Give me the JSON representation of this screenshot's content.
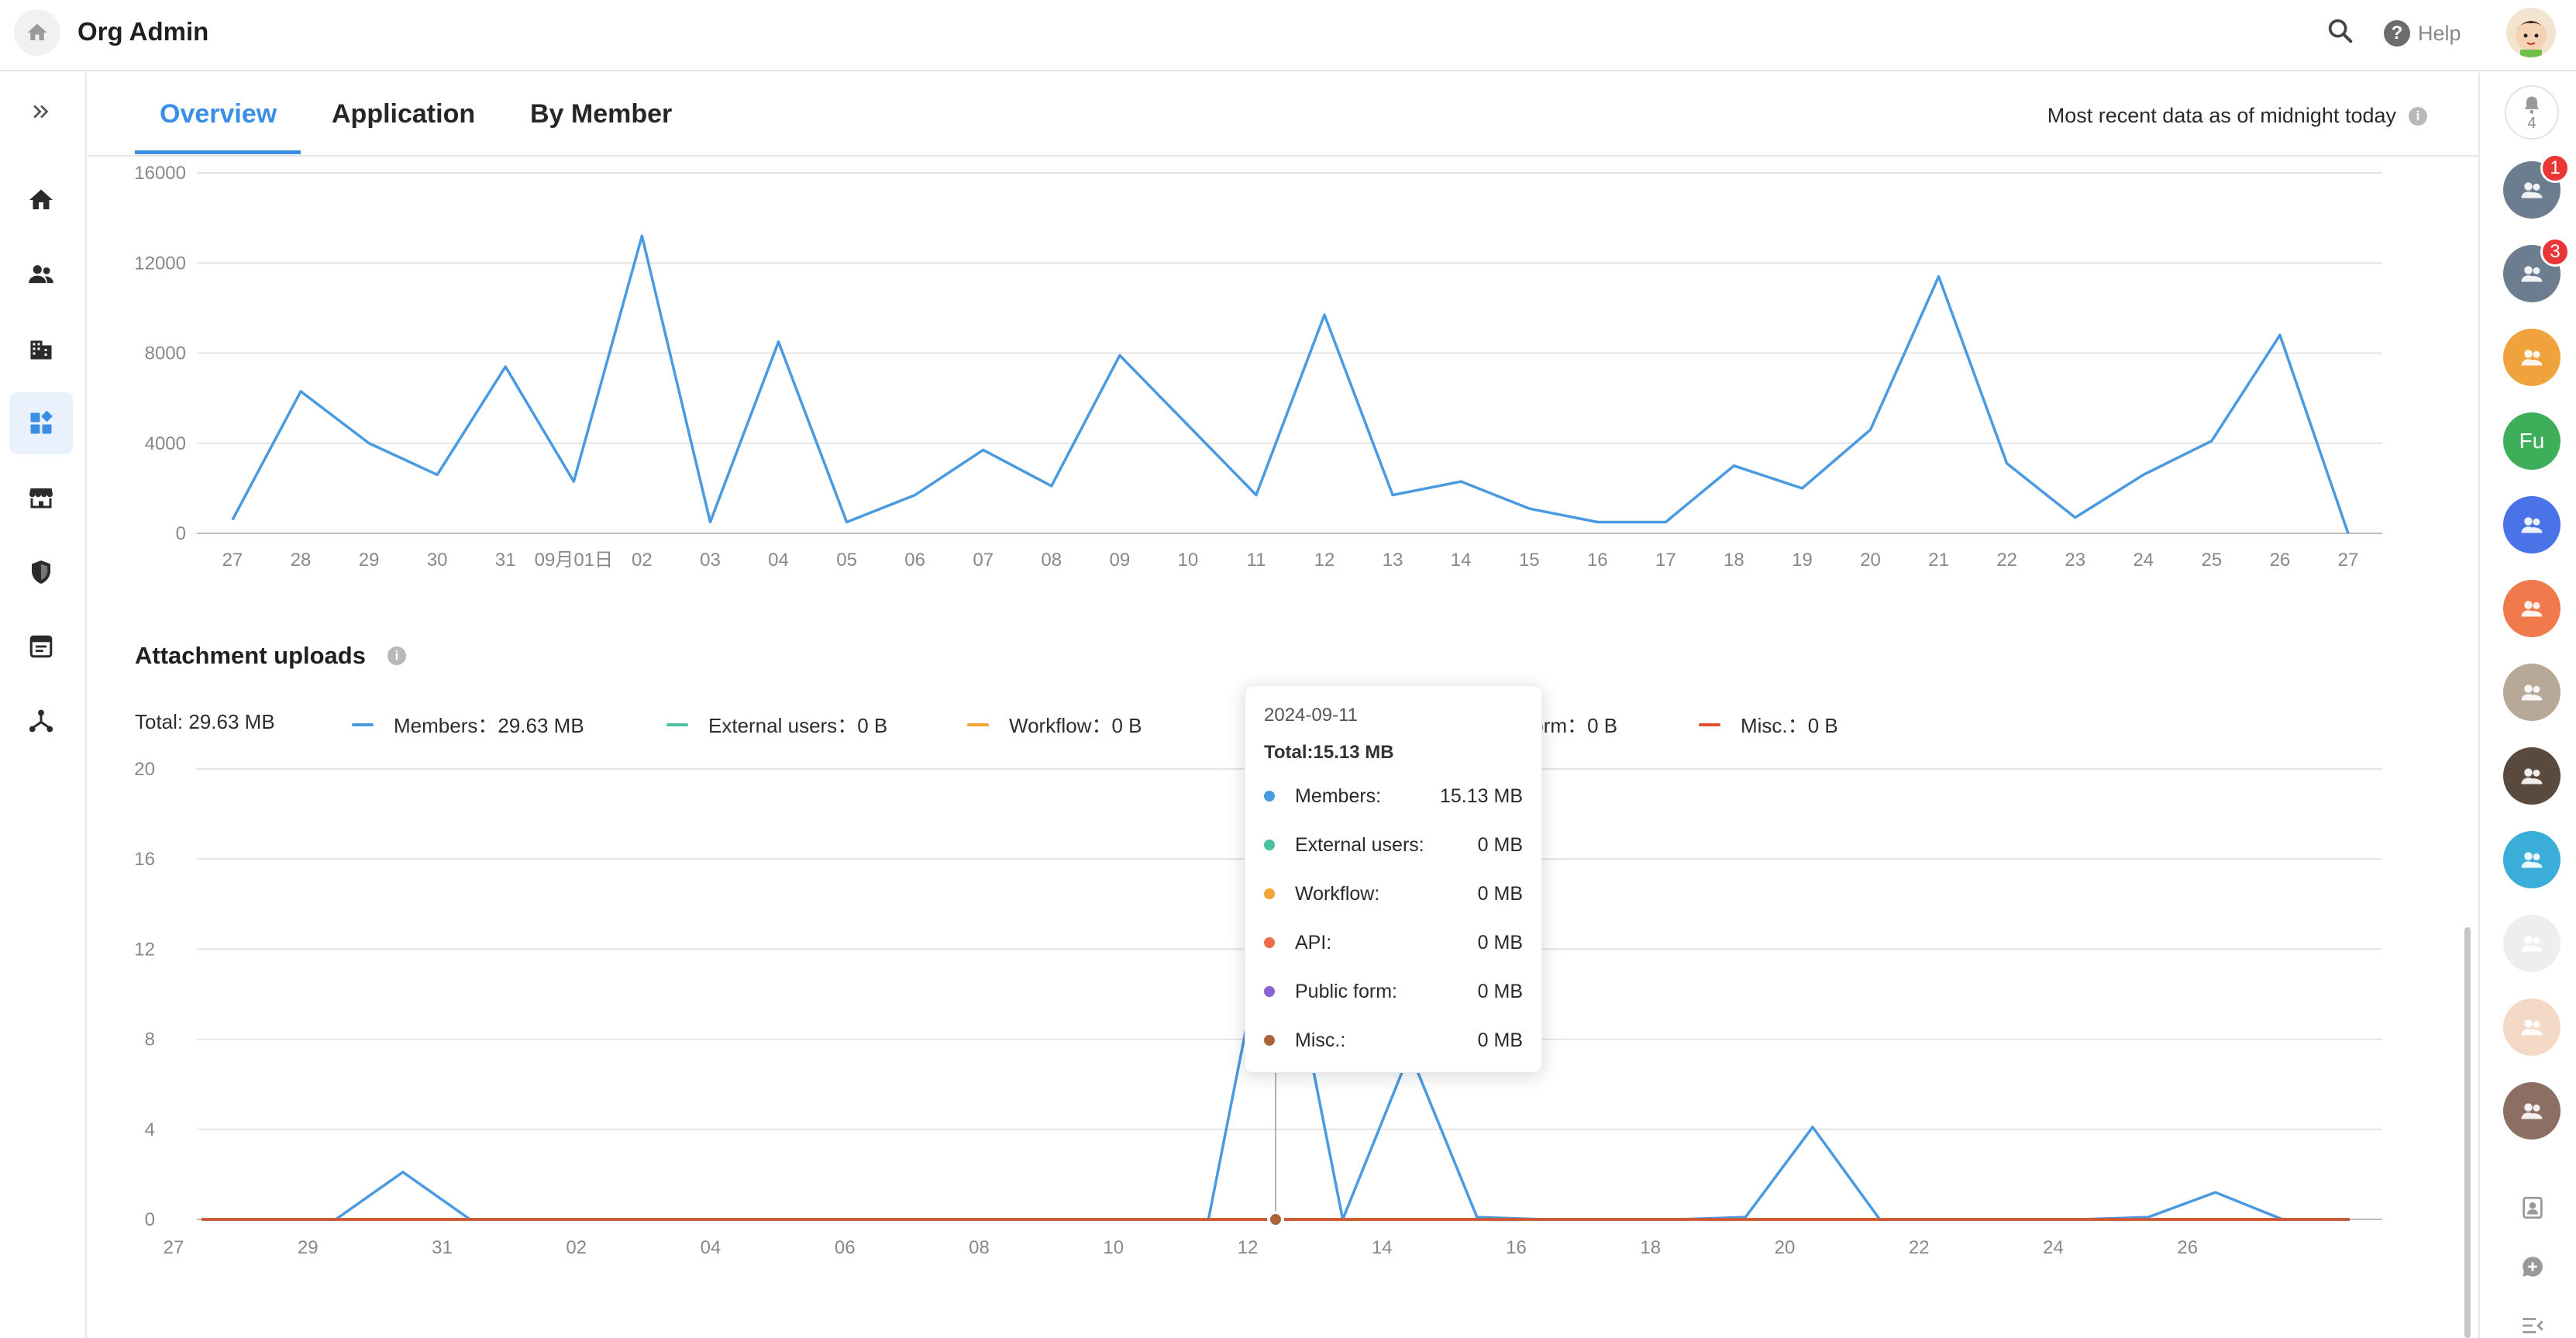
{
  "app": {
    "title": "Org Admin",
    "help_label": "Help"
  },
  "icons": {
    "home": "home-icon",
    "search": "search-icon",
    "help": "help-circle-icon",
    "expand": "double-chevron-right-icon",
    "nav": [
      "home-icon",
      "members-icon",
      "organization-icon",
      "apps-dashboard-icon",
      "store-icon",
      "security-shield-icon",
      "log-icon",
      "network-icon"
    ]
  },
  "colors": {
    "accent": "#3a8ee6",
    "members": "#4a9ae2",
    "external": "#4cc0a0",
    "workflow": "#f3a43b",
    "api": "#ef6a4a",
    "public_form": "#8a63d2",
    "misc": "#d8542c"
  },
  "tabs": [
    {
      "label": "Overview",
      "active": true
    },
    {
      "label": "Application",
      "active": false
    },
    {
      "label": "By Member",
      "active": false
    }
  ],
  "recent_data_label": "Most recent data as of midnight today",
  "attachment_section": {
    "title": "Attachment uploads"
  },
  "legend": {
    "total": "Total: 29.63 MB",
    "items": [
      {
        "name": "Members",
        "value": "29.63 MB",
        "color": "#4a9ae2"
      },
      {
        "name": "External users",
        "value": "0 B",
        "color": "#4cc0a0"
      },
      {
        "name": "Workflow",
        "value": "0 B",
        "color": "#f3a43b"
      },
      {
        "name": "Public form",
        "value": "0 B",
        "color": "#8a63d2"
      },
      {
        "name": "Misc.",
        "value": "0 B",
        "color": "#d8542c"
      }
    ]
  },
  "tooltip": {
    "date": "2024-09-11",
    "total": "Total:15.13 MB",
    "rows": [
      {
        "name": "Members:",
        "value": "15.13 MB",
        "color": "#4a9ae2"
      },
      {
        "name": "External users:",
        "value": "0 MB",
        "color": "#4cc0a0"
      },
      {
        "name": "Workflow:",
        "value": "0 MB",
        "color": "#f3a43b"
      },
      {
        "name": "API:",
        "value": "0 MB",
        "color": "#ef6a4a"
      },
      {
        "name": "Public form:",
        "value": "0 MB",
        "color": "#8a63d2"
      },
      {
        "name": "Misc.:",
        "value": "0 MB",
        "color": "#a9653a"
      }
    ]
  },
  "right_sidebar": {
    "notification_count": "4",
    "items": [
      {
        "name": "approvals",
        "badge": "1",
        "color": "#6b7d8e"
      },
      {
        "name": "reminders",
        "badge": "3",
        "color": "#6b7d8e"
      },
      {
        "name": "workbench",
        "badge": "",
        "color": "#f0a33c"
      },
      {
        "name": "user-fu",
        "label": "Fu",
        "badge": "",
        "color": "#3fae5a"
      },
      {
        "name": "ai-assistant",
        "badge": "",
        "color": "#4a73e8"
      },
      {
        "name": "group-orange",
        "badge": "",
        "color": "#f07a4b"
      },
      {
        "name": "cat-photo-1",
        "badge": "",
        "color": "#b7a898"
      },
      {
        "name": "cat-photo-2",
        "badge": "",
        "color": "#5a4a3e"
      },
      {
        "name": "group-teal",
        "badge": "",
        "color": "#3aaed8"
      },
      {
        "name": "cartoon-panda",
        "badge": "",
        "color": "#eeeeee"
      },
      {
        "name": "cartoon-face",
        "badge": "",
        "color": "#f3d9c6"
      },
      {
        "name": "group-brown",
        "badge": "",
        "color": "#8d6e63"
      }
    ]
  },
  "chart_data": [
    {
      "type": "line",
      "x": [
        "27",
        "28",
        "29",
        "30",
        "31",
        "09月01日",
        "02",
        "03",
        "04",
        "05",
        "06",
        "07",
        "08",
        "09",
        "10",
        "11",
        "12",
        "13",
        "14",
        "15",
        "16",
        "17",
        "18",
        "19",
        "20",
        "21",
        "22",
        "23",
        "24",
        "25",
        "26",
        "27"
      ],
      "series": [
        {
          "values": [
            600,
            6300,
            4000,
            2600,
            7400,
            2300,
            13200,
            500,
            8500,
            500,
            1700,
            3700,
            2100,
            7900,
            4800,
            1700,
            9700,
            1700,
            2300,
            1100,
            500,
            500,
            3000,
            2000,
            4600,
            11400,
            3100,
            700,
            2600,
            4100,
            8800,
            0
          ]
        }
      ],
      "ylim": [
        0,
        16000
      ],
      "yticks": [
        "0",
        "4000",
        "8000",
        "12000",
        "16000"
      ],
      "grid": true
    },
    {
      "type": "line",
      "title": "Attachment uploads",
      "x": [
        "27",
        "28",
        "29",
        "30",
        "31",
        "09月01日",
        "02",
        "03",
        "04",
        "05",
        "06",
        "07",
        "08",
        "09",
        "10",
        "11",
        "12",
        "13",
        "14",
        "15",
        "16",
        "17",
        "18",
        "19",
        "20",
        "21",
        "22",
        "23",
        "24",
        "25",
        "26",
        "27"
      ],
      "xticks_shown": [
        "27",
        "29",
        "31",
        "02",
        "04",
        "06",
        "08",
        "10",
        "12",
        "14",
        "16",
        "18",
        "20",
        "22",
        "24",
        "26"
      ],
      "series": [
        {
          "name": "Members",
          "values": [
            0,
            0,
            0,
            2.1,
            0,
            0,
            0,
            0,
            0,
            0,
            0,
            0,
            0,
            0,
            0,
            0,
            15.13,
            0,
            7.4,
            0.1,
            0,
            0,
            0,
            0.1,
            4.1,
            0,
            0,
            0,
            0,
            0.1,
            1.2,
            0,
            0
          ],
          "color": "#4a9ae2"
        },
        {
          "name": "External users",
          "values": [
            0,
            0,
            0,
            0,
            0,
            0,
            0,
            0,
            0,
            0,
            0,
            0,
            0,
            0,
            0,
            0,
            0,
            0,
            0,
            0,
            0,
            0,
            0,
            0,
            0,
            0,
            0,
            0,
            0,
            0,
            0,
            0,
            0
          ],
          "color": "#4cc0a0"
        },
        {
          "name": "Workflow",
          "values": [
            0,
            0,
            0,
            0,
            0,
            0,
            0,
            0,
            0,
            0,
            0,
            0,
            0,
            0,
            0,
            0,
            0,
            0,
            0,
            0,
            0,
            0,
            0,
            0,
            0,
            0,
            0,
            0,
            0,
            0,
            0,
            0,
            0
          ],
          "color": "#f3a43b"
        },
        {
          "name": "Public form",
          "values": [
            0,
            0,
            0,
            0,
            0,
            0,
            0,
            0,
            0,
            0,
            0,
            0,
            0,
            0,
            0,
            0,
            0,
            0,
            0,
            0,
            0,
            0,
            0,
            0,
            0,
            0,
            0,
            0,
            0,
            0,
            0,
            0,
            0
          ],
          "color": "#8a63d2"
        },
        {
          "name": "Misc.",
          "values": [
            0,
            0,
            0,
            0,
            0,
            0,
            0,
            0,
            0,
            0,
            0,
            0,
            0,
            0,
            0,
            0,
            0,
            0,
            0,
            0,
            0,
            0,
            0,
            0,
            0,
            0,
            0,
            0,
            0,
            0,
            0,
            0,
            0
          ],
          "color": "#d8542c"
        }
      ],
      "ylim": [
        0,
        20
      ],
      "yticks": [
        "0",
        "4",
        "8",
        "12",
        "16",
        "20"
      ],
      "grid": true,
      "highlighted_date": "2024-09-11"
    }
  ]
}
